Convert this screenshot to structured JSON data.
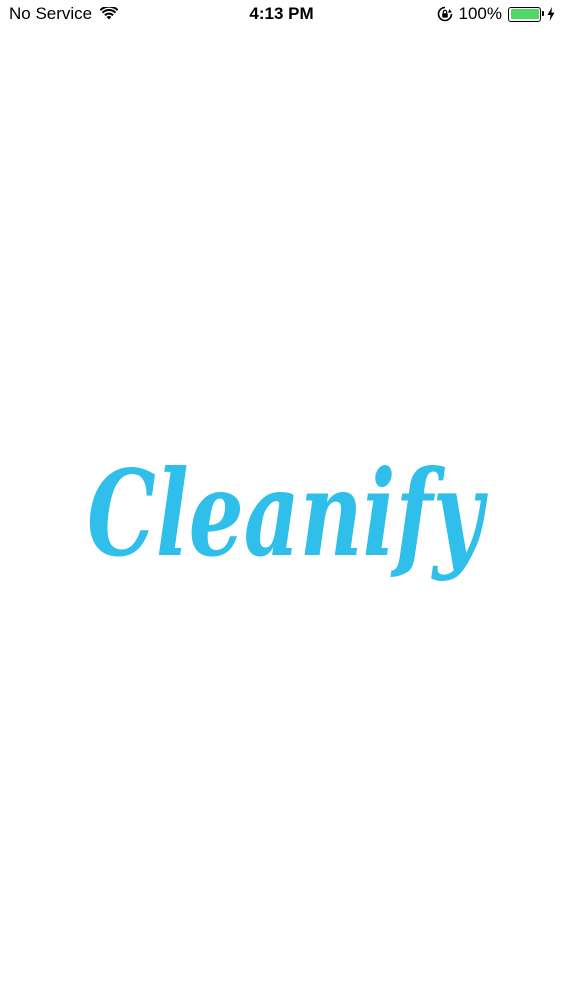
{
  "status_bar": {
    "carrier": "No Service",
    "time": "4:13 PM",
    "battery_percent": "100%",
    "battery_level": 1.0,
    "icons": [
      "wifi-icon",
      "orientation-lock-icon",
      "battery-icon",
      "charging-bolt-icon"
    ]
  },
  "splash": {
    "logo_text": "Cleanify",
    "logo_color": "#2fbfea",
    "battery_color": "#4cd964"
  }
}
